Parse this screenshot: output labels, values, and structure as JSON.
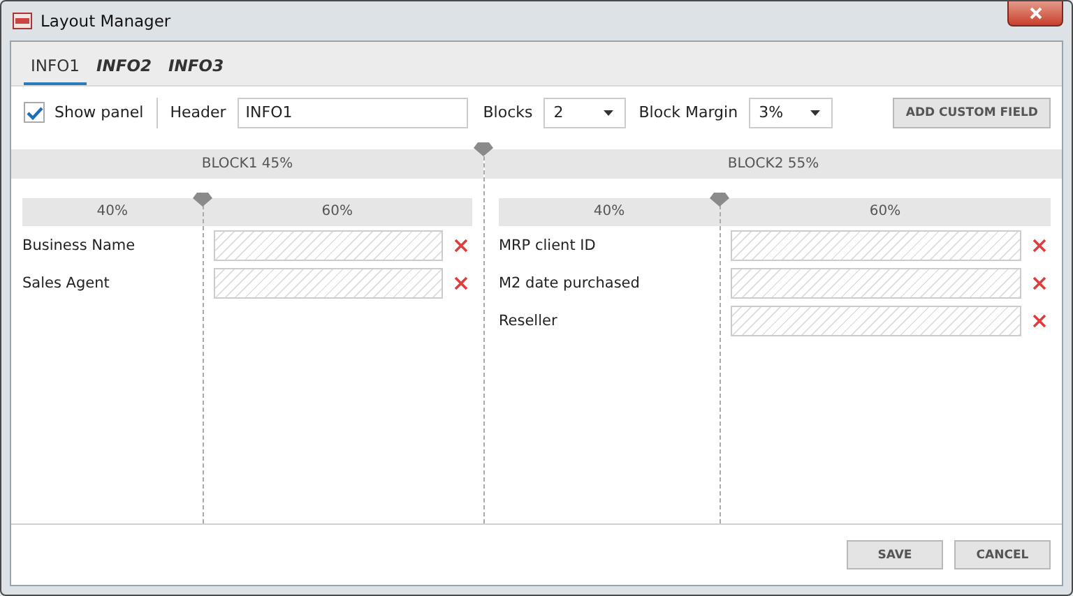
{
  "window": {
    "title": "Layout Manager"
  },
  "tabs": [
    {
      "label": "INFO1",
      "selected": true
    },
    {
      "label": "INFO2",
      "selected": false
    },
    {
      "label": "INFO3",
      "selected": false
    }
  ],
  "toolbar": {
    "show_panel": {
      "label": "Show panel",
      "checked": true
    },
    "header": {
      "label": "Header",
      "value": "INFO1"
    },
    "blocks": {
      "label": "Blocks",
      "value": "2"
    },
    "block_margin": {
      "label": "Block Margin",
      "value": "3%"
    },
    "add_button": "ADD CUSTOM FIELD"
  },
  "split": {
    "level": 0.45
  },
  "blocks": [
    {
      "title": "BLOCK1 45%",
      "columns": [
        "40%",
        "60%"
      ],
      "split": {
        "level": 0.4
      },
      "fields": [
        "Business Name",
        "Sales Agent"
      ]
    },
    {
      "title": "BLOCK2 55%",
      "columns": [
        "40%",
        "60%"
      ],
      "split": {
        "level": 0.4
      },
      "fields": [
        "MRP client ID",
        "M2 date purchased",
        "Reseller"
      ]
    }
  ],
  "buttons": [
    "SAVE",
    "CANCEL"
  ]
}
